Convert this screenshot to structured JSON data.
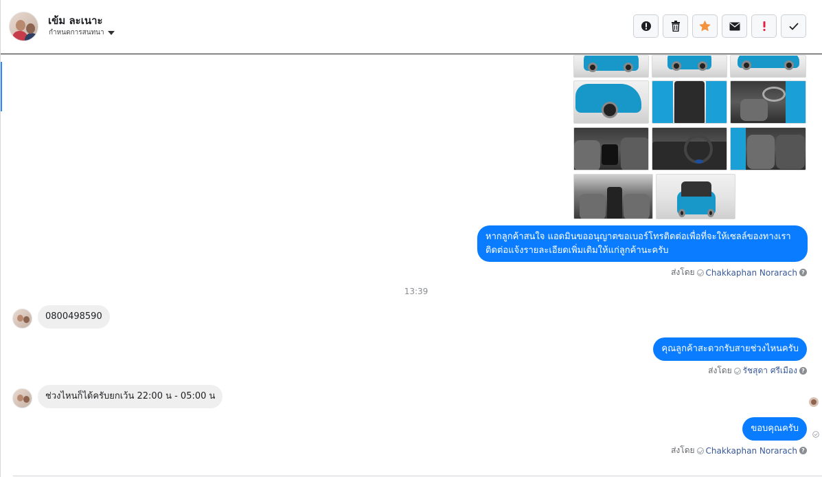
{
  "header": {
    "contact_name": "เข้ม ละเนาะ",
    "assign_label": "กำหนดการสนทนา",
    "actions": [
      {
        "name": "report-icon",
        "label": "!"
      },
      {
        "name": "trash-icon",
        "label": "delete"
      },
      {
        "name": "star-icon",
        "label": "star"
      },
      {
        "name": "mail-icon",
        "label": "unread"
      },
      {
        "name": "spam-icon",
        "label": "!"
      },
      {
        "name": "check-icon",
        "label": "done"
      }
    ],
    "star_color": "#f5923e",
    "spam_color": "#e41e3f"
  },
  "messages": {
    "out_1": {
      "line1": "หากลูกค้าสนใจ แอดมินขออนุญาตขอเบอร์โทรติดต่อเพื่อที่จะให้เซลล์ของทางเรา",
      "line2": "ติดต่อแจ้งรายละเอียดเพิ่มเติมให้แก่ลูกค้านะครับ",
      "sent_by_prefix": "ส่งโดย",
      "sender": "Chakkaphan Norarach"
    },
    "timestamp": "13:39",
    "in_1": {
      "text": "0800498590"
    },
    "out_2": {
      "text": "คุณลูกค้าสะดวกรับสายช่วงไหนครับ",
      "sent_by_prefix": "ส่งโดย",
      "sender": "รัชสุดา ศรีเมือง"
    },
    "in_2": {
      "text": "ช่วงไหนก็ได้ครับยกเว้น 22:00 น - 05:00 น"
    },
    "out_3": {
      "text": "ขอบคุณครับ",
      "sent_by_prefix": "ส่งโดย",
      "sender": "Chakkaphan Norarach"
    }
  },
  "colors": {
    "outgoing_bubble": "#0a7cff",
    "incoming_bubble": "#efefef",
    "sender_link": "#385898",
    "car_blue": "#1798c9"
  }
}
